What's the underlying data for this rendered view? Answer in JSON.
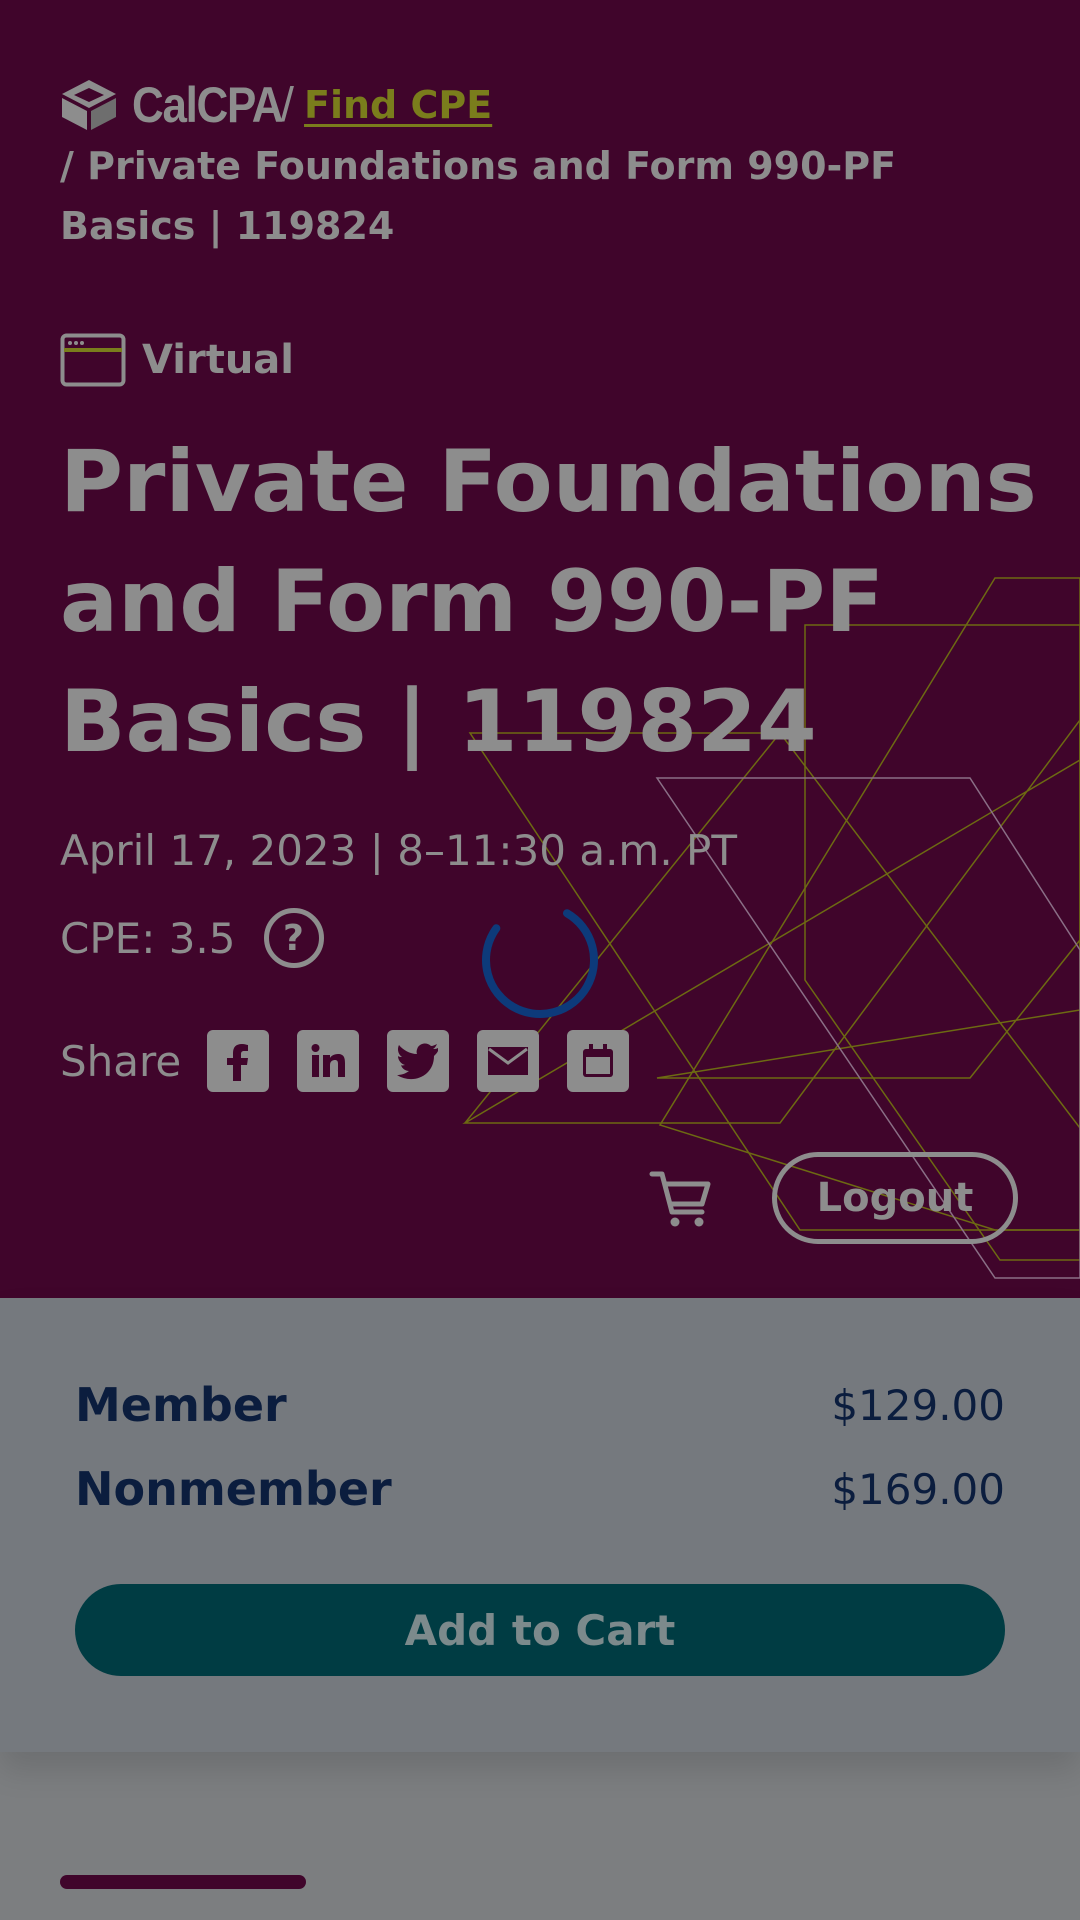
{
  "header": {
    "logo_text": "CalCPA",
    "logo_slash": "/",
    "breadcrumb_link": "Find CPE",
    "breadcrumb_trail": "/ Private Foundations and Form 990-PF Basics | 119824"
  },
  "event": {
    "format": "Virtual",
    "format_icon": "browser-window-icon",
    "title": "Private Foundations and Form 990-PF Basics | 119824",
    "date_time": "April 17, 2023 | 8–11:30 a.m. PT",
    "cpe": "CPE: 3.5",
    "help_icon": "question-mark-icon"
  },
  "share": {
    "label": "Share",
    "buttons": [
      "facebook-icon",
      "linkedin-icon",
      "twitter-icon",
      "email-icon",
      "calendar-icon"
    ]
  },
  "actions": {
    "cart_icon": "cart-icon",
    "logout_label": "Logout"
  },
  "pricing": {
    "rows": [
      {
        "label": "Member",
        "price": "$129.00"
      },
      {
        "label": "Nonmember",
        "price": "$169.00"
      }
    ],
    "add_to_cart_label": "Add to Cart"
  },
  "colors": {
    "hero_bg": "#40052b",
    "link": "#7a7d1c",
    "price_text": "#0b1d3e",
    "cta_bg": "#003c43",
    "spinner": "#0d3a7a"
  }
}
